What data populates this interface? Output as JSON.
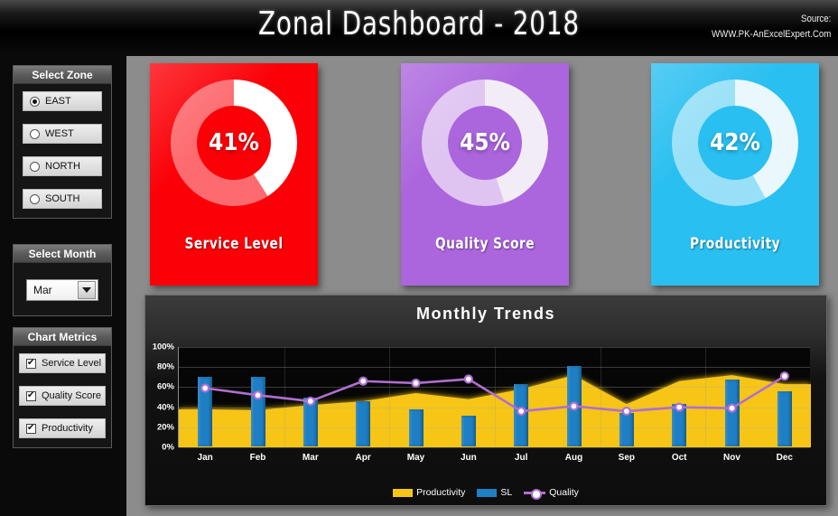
{
  "header": {
    "title": "Zonal Dashboard - 2018",
    "source_label": "Source:",
    "source_url": "WWW.PK-AnExcelExpert.Com"
  },
  "sidebar": {
    "zone_panel": {
      "title": "Select Zone",
      "options": [
        {
          "label": "EAST",
          "selected": true
        },
        {
          "label": "WEST",
          "selected": false
        },
        {
          "label": "NORTH",
          "selected": false
        },
        {
          "label": "SOUTH",
          "selected": false
        }
      ]
    },
    "month_panel": {
      "title": "Select Month",
      "selected": "Mar",
      "options": [
        "Jan",
        "Feb",
        "Mar",
        "Apr",
        "May",
        "Jun",
        "Jul",
        "Aug",
        "Sep",
        "Oct",
        "Nov",
        "Dec"
      ]
    },
    "metrics_panel": {
      "title": "Chart Metrics",
      "options": [
        {
          "label": "Service Level",
          "checked": true
        },
        {
          "label": "Quality Score",
          "checked": true
        },
        {
          "label": "Productivity",
          "checked": true
        }
      ]
    }
  },
  "kpi_cards": [
    {
      "label": "Service Level",
      "value": "41%",
      "percent": 41,
      "card_color": "#fb0007",
      "ring_color": "#ffffff",
      "track_color": "rgba(255,255,255,0.42)"
    },
    {
      "label": "Quality Score",
      "value": "45%",
      "percent": 45,
      "card_color": "#ab65dd",
      "ring_color": "#f2ecf7",
      "track_color": "rgba(255,255,255,0.62)"
    },
    {
      "label": "Productivity",
      "value": "42%",
      "percent": 42,
      "card_color": "#29bff0",
      "ring_color": "#eaf7fd",
      "track_color": "rgba(255,255,255,0.52)"
    }
  ],
  "chart_data": {
    "type": "bar",
    "title": "Monthly Trends",
    "xlabel": "",
    "ylabel": "",
    "ylim": [
      0,
      100
    ],
    "ytick_labels": [
      "0%",
      "20%",
      "40%",
      "60%",
      "80%",
      "100%"
    ],
    "ytick_values": [
      0,
      20,
      40,
      60,
      80,
      100
    ],
    "grid": true,
    "legend_position": "bottom",
    "categories": [
      "Jan",
      "Feb",
      "Mar",
      "Apr",
      "May",
      "Jun",
      "Jul",
      "Aug",
      "Sep",
      "Oct",
      "Nov",
      "Dec"
    ],
    "series": [
      {
        "name": "Productivity",
        "type": "area",
        "color": "#f6c518",
        "values": [
          38,
          37,
          42,
          46,
          54,
          48,
          58,
          72,
          43,
          66,
          72,
          63
        ]
      },
      {
        "name": "SL",
        "type": "bar",
        "color": "#1f7fc4",
        "values": [
          69,
          69,
          49,
          45,
          37,
          31,
          62,
          80,
          33,
          42,
          67,
          55
        ]
      },
      {
        "name": "Quality",
        "type": "line",
        "color": "#b06fd0",
        "marker_color": "#ffffff",
        "values": [
          59,
          52,
          46,
          66,
          64,
          68,
          36,
          41,
          36,
          40,
          39,
          71
        ]
      }
    ]
  }
}
